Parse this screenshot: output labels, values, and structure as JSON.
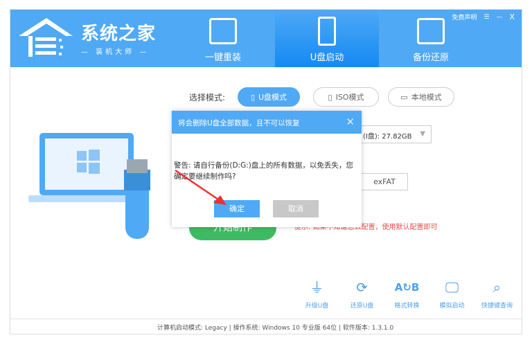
{
  "app": {
    "title": "系统之家",
    "subtitle": "— 装机大师 —"
  },
  "top_links": {
    "feedback": "免费声明",
    "min": "—",
    "close": "X"
  },
  "tabs": [
    {
      "label": "一键重装"
    },
    {
      "label": "U盘启动"
    },
    {
      "label": "备份还原"
    }
  ],
  "mode": {
    "label": "选择模式:",
    "options": [
      {
        "label": "U盘模式"
      },
      {
        "label": "ISO模式"
      },
      {
        "label": "本地模式"
      }
    ]
  },
  "drive": {
    "value": "(I盘): 27.82GB"
  },
  "filesystem": {
    "value": "exFAT"
  },
  "start_button": "开始制作",
  "tip": "提示: 如果不知道怎么配置，使用默认配置即可",
  "tools": [
    {
      "label": "升级U盘"
    },
    {
      "label": "还原U盘"
    },
    {
      "label": "格式转换"
    },
    {
      "label": "模拟启动"
    },
    {
      "label": "快捷键查询"
    }
  ],
  "footer": "计算机启动模式: Legacy | 操作系统: Windows 10 专业版 64位 | 软件版本: 1.3.1.0",
  "dialog": {
    "title": "将会删除U盘全部数据，且不可以恢复",
    "message": "警告: 请自行备份(D:G:)盘上的所有数据，以免丢失，您确定要继续制作吗?",
    "ok": "确定",
    "cancel": "取消"
  }
}
